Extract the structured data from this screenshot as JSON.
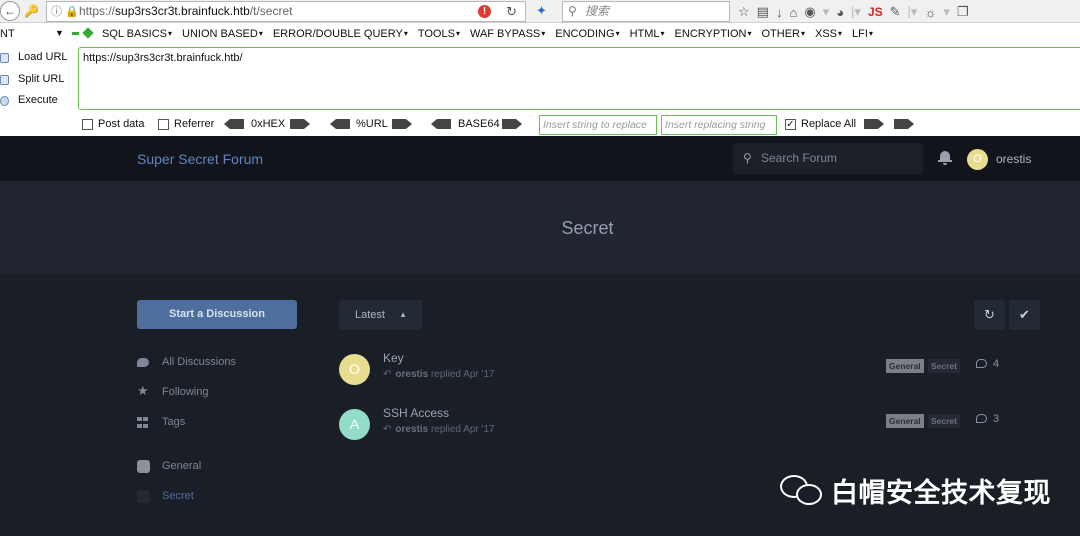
{
  "browser": {
    "url_prefix": "https://",
    "url_host": "sup3rs3cr3t.brainfuck.htb",
    "url_path": "/t/secret",
    "search_placeholder": "搜索",
    "js_label": "JS"
  },
  "hackbar": {
    "dropdown_label": "NT",
    "menus": [
      "SQL BASICS",
      "UNION BASED",
      "ERROR/DOUBLE QUERY",
      "TOOLS",
      "WAF BYPASS",
      "ENCODING",
      "HTML",
      "ENCRYPTION",
      "OTHER",
      "XSS",
      "LFI"
    ],
    "load_url": "Load URL",
    "split_url": "Split URL",
    "execute": "Execute",
    "url_value": "https://sup3rs3cr3t.brainfuck.htb/",
    "post_data": "Post data",
    "referrer": "Referrer",
    "hex": "0xHEX",
    "url_enc": "%URL",
    "base64": "BASE64",
    "replace_placeholder": "Insert string to replace",
    "replacing_placeholder": "Insert replacing string",
    "replace_all": "Replace All",
    "replace_all_checked": true
  },
  "forum": {
    "brand": "Super Secret Forum",
    "search_placeholder": "Search Forum",
    "user": {
      "initial": "O",
      "name": "orestis",
      "color": "#e8dd8e"
    },
    "hero_title": "Secret",
    "start_button": "Start a Discussion",
    "sort_label": "Latest",
    "nav": [
      {
        "label": "All Discussions",
        "icon": "chat-bubble-icon"
      },
      {
        "label": "Following",
        "icon": "star-icon"
      },
      {
        "label": "Tags",
        "icon": "tags-grid-icon"
      }
    ],
    "tag_nav": [
      {
        "label": "General",
        "color": "#8d9098",
        "text_color": "#7e8797"
      },
      {
        "label": "Secret",
        "color": "#232833",
        "text_color": "#4e6e9e"
      }
    ],
    "discussions": [
      {
        "initial": "O",
        "avatar_color": "#e8dd8e",
        "title": "Key",
        "author": "orestis",
        "action": "replied",
        "date": "Apr '17",
        "tags": [
          "General",
          "Secret"
        ],
        "replies": "4"
      },
      {
        "initial": "A",
        "avatar_color": "#92dcc8",
        "title": "SSH Access",
        "author": "orestis",
        "action": "replied",
        "date": "Apr '17",
        "tags": [
          "General",
          "Secret"
        ],
        "replies": "3"
      }
    ]
  },
  "watermark": {
    "text": "白帽安全技术复现"
  }
}
